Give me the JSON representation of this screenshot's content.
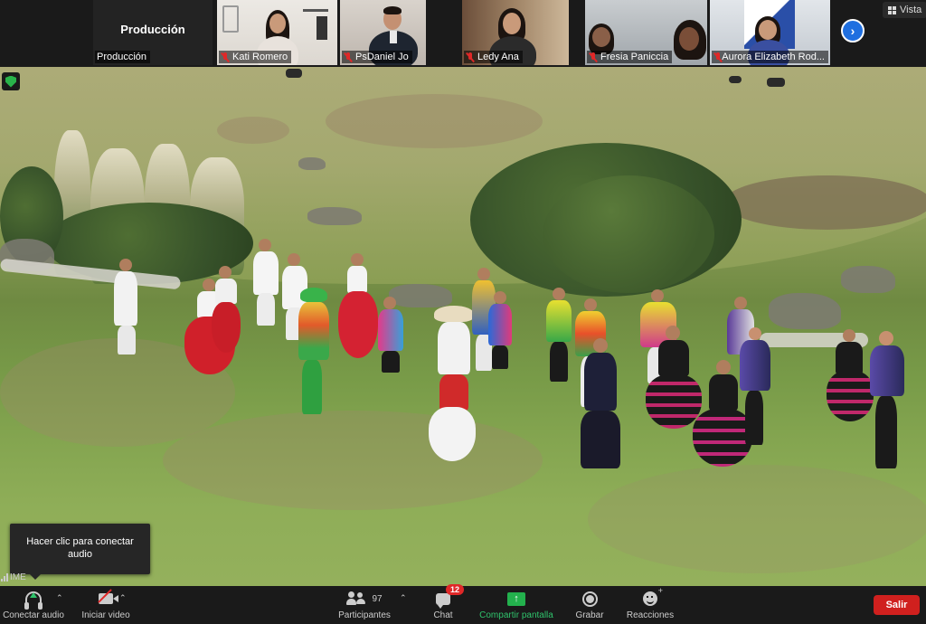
{
  "gallery": {
    "production_tile": {
      "big_label": "Producción",
      "name": "Producción"
    },
    "participants": [
      {
        "name": "Kati Romero",
        "muted": true
      },
      {
        "name": "PsDaniel Jo",
        "muted": true
      },
      {
        "name": "Ledy Ana",
        "muted": true
      },
      {
        "name": "Fresia Paniccia",
        "muted": true
      },
      {
        "name": "Aurora Elizabeth Rod...",
        "muted": true
      }
    ],
    "next_icon": "chevron-right-icon",
    "view_label": "Vista"
  },
  "overlay": {
    "audio_tooltip": "Hacer clic para conectar audio",
    "ime_label": "IME"
  },
  "toolbar": {
    "connect_audio": "Conectar audio",
    "start_video": "Iniciar video",
    "participants_label": "Participantes",
    "participants_count": "97",
    "chat_label": "Chat",
    "chat_badge": "12",
    "share_label": "Compartir pantalla",
    "record_label": "Grabar",
    "reactions_label": "Reacciones",
    "leave_label": "Salir"
  },
  "colors": {
    "accent_green": "#2fc46c",
    "leave_red": "#d0201e",
    "mute_red": "#e02828",
    "next_blue": "#1f6fe0"
  }
}
